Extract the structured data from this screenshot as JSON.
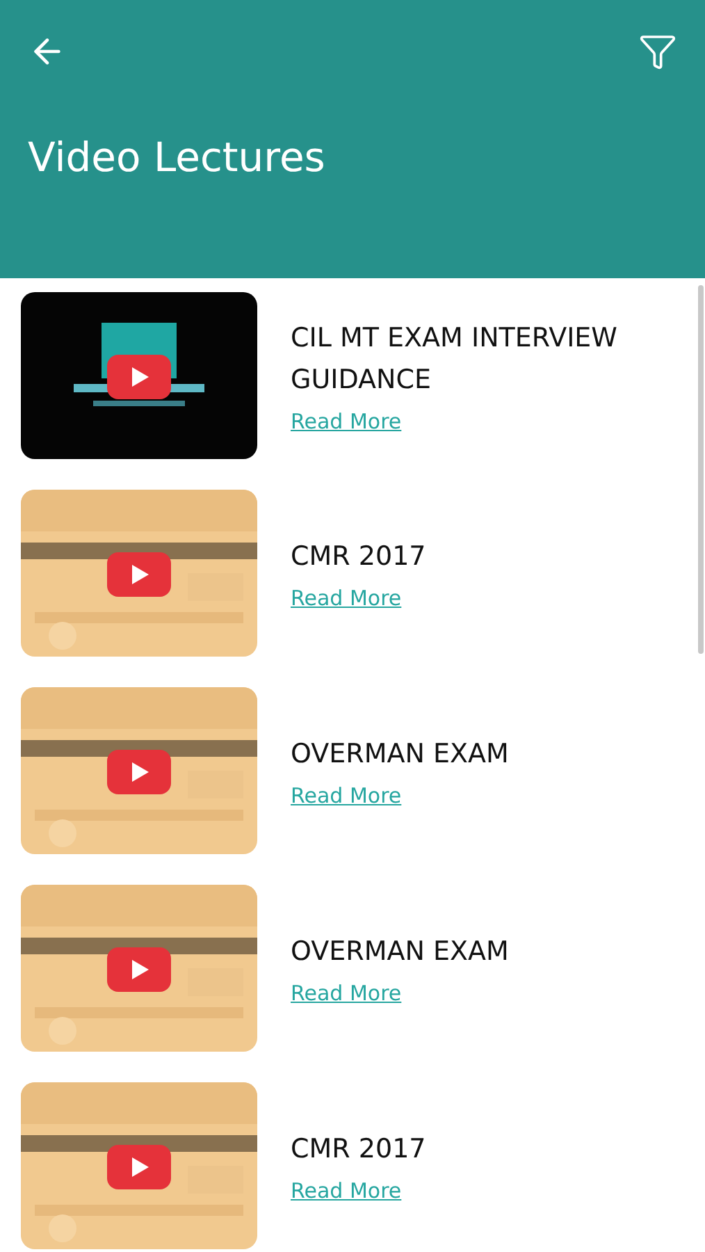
{
  "header": {
    "title": "Video Lectures"
  },
  "videos": [
    {
      "title": "CIL MT EXAM INTERVIEW GUIDANCE",
      "link": "Read More"
    },
    {
      "title": "CMR 2017",
      "link": "Read More"
    },
    {
      "title": "OVERMAN EXAM",
      "link": "Read More"
    },
    {
      "title": "OVERMAN EXAM",
      "link": "Read More"
    },
    {
      "title": "CMR 2017",
      "link": "Read More"
    }
  ]
}
